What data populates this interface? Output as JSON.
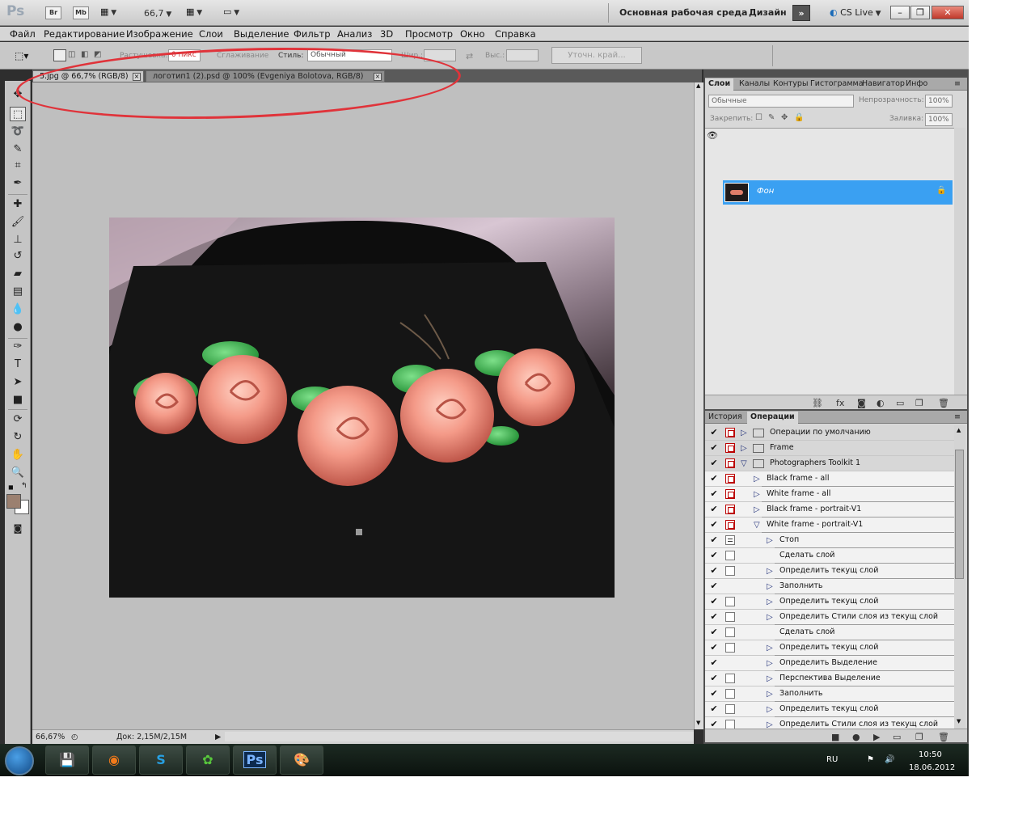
{
  "app": {
    "logo": "Ps",
    "bridge_label": "Br",
    "minibridge_label": "Mb",
    "zoom_value": "66,7",
    "workspace_name": "Основная рабочая среда",
    "design_label": "Дизайн",
    "more_label": "»",
    "cslive_label": "CS Live"
  },
  "menu": [
    "Файл",
    "Редактирование",
    "Изображение",
    "Слои",
    "Выделение",
    "Фильтр",
    "Анализ",
    "3D",
    "Просмотр",
    "Окно",
    "Справка"
  ],
  "options": {
    "feather_label": "Растушевка:",
    "feather_value": "0 пикс",
    "antialias_label": "Сглаживание",
    "style_label": "Стиль:",
    "style_value": "Обычный",
    "width_label": "Шир.:",
    "height_label": "Выс.:",
    "refine_label": "Уточн. край..."
  },
  "tabs": [
    {
      "label": "5.jpg @ 66,7% (RGB/8)"
    },
    {
      "label": "логотип1 (2).psd @ 100% (Evgeniya Bolotova, RGB/8)"
    }
  ],
  "status": {
    "zoom": "66,67%",
    "doc": "Док: 2,15M/2,15M"
  },
  "layers_panel": {
    "tabs": [
      "Слои",
      "Каналы",
      "Контуры",
      "Гистограмма",
      "Навигатор",
      "Инфо"
    ],
    "blend_mode": "Обычные",
    "opacity_label": "Непрозрачность:",
    "opacity_value": "100%",
    "lock_label": "Закрепить:",
    "fill_label": "Заливка:",
    "fill_value": "100%",
    "layers": [
      {
        "name": "Фон"
      }
    ]
  },
  "actions_panel": {
    "tabs": [
      "История",
      "Операции"
    ],
    "items": [
      {
        "label": "Операции по умолчанию",
        "level": 0,
        "folder": true,
        "expanded": false,
        "dlg": "red",
        "shaded": true
      },
      {
        "label": "Frame",
        "level": 0,
        "folder": true,
        "expanded": false,
        "dlg": "red",
        "shaded": true
      },
      {
        "label": "Photographers Toolkit 1",
        "level": 0,
        "folder": true,
        "expanded": true,
        "dlg": "red",
        "shaded": true
      },
      {
        "label": "Black frame - all",
        "level": 1,
        "expanded": false,
        "dlg": "red"
      },
      {
        "label": "White frame - all",
        "level": 1,
        "expanded": false,
        "dlg": "red"
      },
      {
        "label": "Black frame - portrait-V1",
        "level": 1,
        "expanded": false,
        "dlg": "red"
      },
      {
        "label": "White frame - portrait-V1",
        "level": 1,
        "expanded": true,
        "dlg": "red"
      },
      {
        "label": "Стоп",
        "level": 2,
        "expanded": false,
        "dlg": "box"
      },
      {
        "label": "Сделать слой",
        "level": 2,
        "leaf": true,
        "dlg": "empty"
      },
      {
        "label": "Определить текущ слой",
        "level": 2,
        "expanded": false,
        "dlg": "empty"
      },
      {
        "label": "Заполнить",
        "level": 2,
        "expanded": false,
        "dlg": "none"
      },
      {
        "label": "Определить текущ слой",
        "level": 2,
        "expanded": false,
        "dlg": "empty"
      },
      {
        "label": "Определить Стили слоя из текущ слой",
        "level": 2,
        "expanded": false,
        "dlg": "empty"
      },
      {
        "label": "Сделать слой",
        "level": 2,
        "leaf": true,
        "dlg": "empty"
      },
      {
        "label": "Определить текущ слой",
        "level": 2,
        "expanded": false,
        "dlg": "empty"
      },
      {
        "label": "Определить Выделение",
        "level": 2,
        "expanded": false,
        "dlg": "none"
      },
      {
        "label": "Перспектива Выделение",
        "level": 2,
        "expanded": false,
        "dlg": "empty"
      },
      {
        "label": "Заполнить",
        "level": 2,
        "expanded": false,
        "dlg": "empty"
      },
      {
        "label": "Определить текущ слой",
        "level": 2,
        "expanded": false,
        "dlg": "empty"
      },
      {
        "label": "Определить Стили слоя из текущ слой",
        "level": 2,
        "expanded": false,
        "dlg": "empty"
      }
    ]
  },
  "taskbar": {
    "lang": "RU",
    "time": "10:50",
    "date": "18.06.2012",
    "ps_label": "Ps"
  },
  "colors": {
    "selected_layer": "#3aa0f2",
    "annotation": "#e0333a",
    "canvas_bg": "#bfbfbf",
    "foreground_color": "#9b8070"
  }
}
